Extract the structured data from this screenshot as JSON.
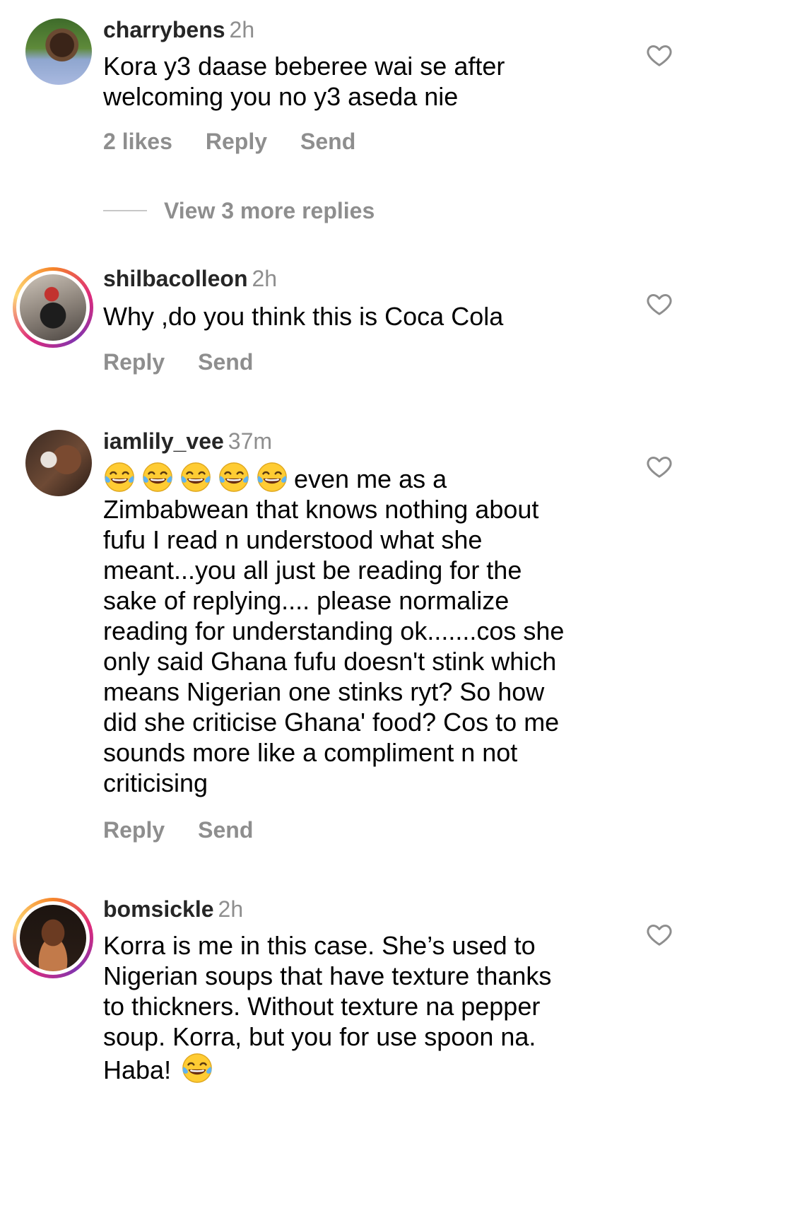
{
  "comments": [
    {
      "username": "charrybens",
      "time": "2h",
      "text": "Kora y3 daase beberee wai se after\nwelcoming you no y3 aseda nie",
      "likes": "2 likes",
      "reply": "Reply",
      "send": "Send"
    },
    {
      "username": "shilbacolleon",
      "time": "2h",
      "text": "Why ,do you think this is Coca Cola",
      "reply": "Reply",
      "send": "Send"
    },
    {
      "username": "iamlily_vee",
      "time": "37m",
      "text_lead": "even me as a",
      "text": "Zimbabwean that knows nothing about\nfufu I read n understood what she\nmeant...you all just be reading for the\nsake of replying.... please normalize\nreading for understanding ok.......cos she\nonly said Ghana fufu doesn't stink which\nmeans Nigerian one stinks ryt? So how\ndid she criticise Ghana' food? Cos to me\nsounds more like a compliment n not\ncriticising",
      "reply": "Reply",
      "send": "Send"
    },
    {
      "username": "bomsickle",
      "time": "2h",
      "text": "Korra is me in this case. She’s used to\nNigerian soups that have texture thanks\nto thickners. Without texture na pepper\nsoup. Korra, but you for use spoon na.",
      "text_tail": "Haba!"
    }
  ],
  "view_replies": "View 3 more replies",
  "icons": {
    "heart": "heart-outline-icon",
    "emoji": "face-with-tears-of-joy-icon"
  },
  "colors": {
    "muted": "#8e8e8e",
    "text": "#000000",
    "username": "#262626",
    "story_ring_start": "#f58529",
    "story_ring_end": "#dd2a7b"
  }
}
